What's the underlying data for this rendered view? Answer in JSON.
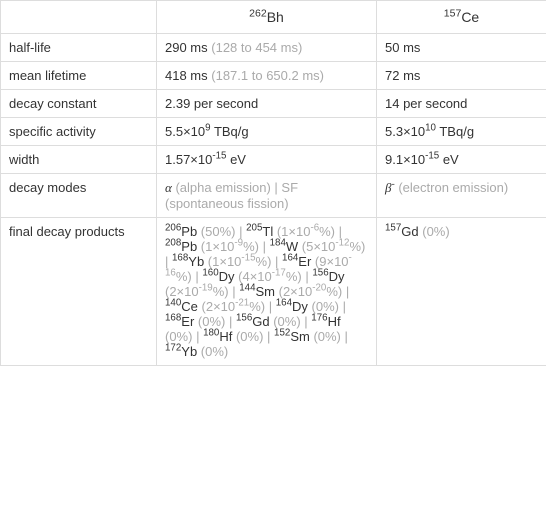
{
  "headers": {
    "col1": {
      "sup": "262",
      "el": "Bh"
    },
    "col2": {
      "sup": "157",
      "el": "Ce"
    }
  },
  "rows": {
    "half_life": {
      "label": "half-life",
      "c1": {
        "v": "290 ms",
        "g": "(128 to 454 ms)"
      },
      "c2": {
        "v": "50 ms"
      }
    },
    "mean_lifetime": {
      "label": "mean lifetime",
      "c1": {
        "v": "418 ms",
        "g": "(187.1 to 650.2 ms)"
      },
      "c2": {
        "v": "72 ms"
      }
    },
    "decay_constant": {
      "label": "decay constant",
      "c1": {
        "v": "2.39 per second"
      },
      "c2": {
        "v": "14 per second"
      }
    },
    "specific_activity": {
      "label": "specific activity",
      "c1": {
        "pre": "5.5×10",
        "sup": "9",
        "post": " TBq/g"
      },
      "c2": {
        "pre": "5.3×10",
        "sup": "10",
        "post": " TBq/g"
      }
    },
    "width": {
      "label": "width",
      "c1": {
        "pre": "1.57×10",
        "sup": "-15",
        "post": " eV"
      },
      "c2": {
        "pre": "9.1×10",
        "sup": "-15",
        "post": " eV"
      }
    },
    "decay_modes": {
      "label": "decay modes",
      "c1": {
        "sym": "α",
        "txt": " (alpha emission) | SF (spontaneous fission)"
      },
      "c2": {
        "sym": "β",
        "sup": "-",
        "txt": " (electron emission)"
      }
    },
    "final_decay": {
      "label": "final decay products",
      "c1": {
        "items": [
          {
            "sup": "206",
            "el": "Pb",
            "pct": "(50%)"
          },
          {
            "sup": "205",
            "el": "Tl",
            "pctpre": "(1×10",
            "pctsup": "-6",
            "pctpost": "%)"
          },
          {
            "sup": "208",
            "el": "Pb",
            "pctpre": "(1×10",
            "pctsup": "-9",
            "pctpost": "%)"
          },
          {
            "sup": "184",
            "el": "W",
            "pctpre": "(5×10",
            "pctsup": "-12",
            "pctpost": "%)"
          },
          {
            "sup": "168",
            "el": "Yb",
            "pctpre": "(1×10",
            "pctsup": "-15",
            "pctpost": "%)"
          },
          {
            "sup": "164",
            "el": "Er",
            "pctpre": "(9×10",
            "pctsup": "-16",
            "pctpost": "%)"
          },
          {
            "sup": "160",
            "el": "Dy",
            "pctpre": "(4×10",
            "pctsup": "-17",
            "pctpost": "%)"
          },
          {
            "sup": "156",
            "el": "Dy",
            "pctpre": "(2×10",
            "pctsup": "-19",
            "pctpost": "%)"
          },
          {
            "sup": "144",
            "el": "Sm",
            "pctpre": "(2×10",
            "pctsup": "-20",
            "pctpost": "%)"
          },
          {
            "sup": "140",
            "el": "Ce",
            "pctpre": "(2×10",
            "pctsup": "-21",
            "pctpost": "%)"
          },
          {
            "sup": "164",
            "el": "Dy",
            "pct": "(0%)"
          },
          {
            "sup": "168",
            "el": "Er",
            "pct": "(0%)"
          },
          {
            "sup": "156",
            "el": "Gd",
            "pct": "(0%)"
          },
          {
            "sup": "176",
            "el": "Hf",
            "pct": "(0%)"
          },
          {
            "sup": "180",
            "el": "Hf",
            "pct": "(0%)"
          },
          {
            "sup": "152",
            "el": "Sm",
            "pct": "(0%)"
          },
          {
            "sup": "172",
            "el": "Yb",
            "pct": "(0%)"
          }
        ]
      },
      "c2": {
        "items": [
          {
            "sup": "157",
            "el": "Gd",
            "pct": "(0%)"
          }
        ]
      }
    }
  },
  "sep": " | "
}
